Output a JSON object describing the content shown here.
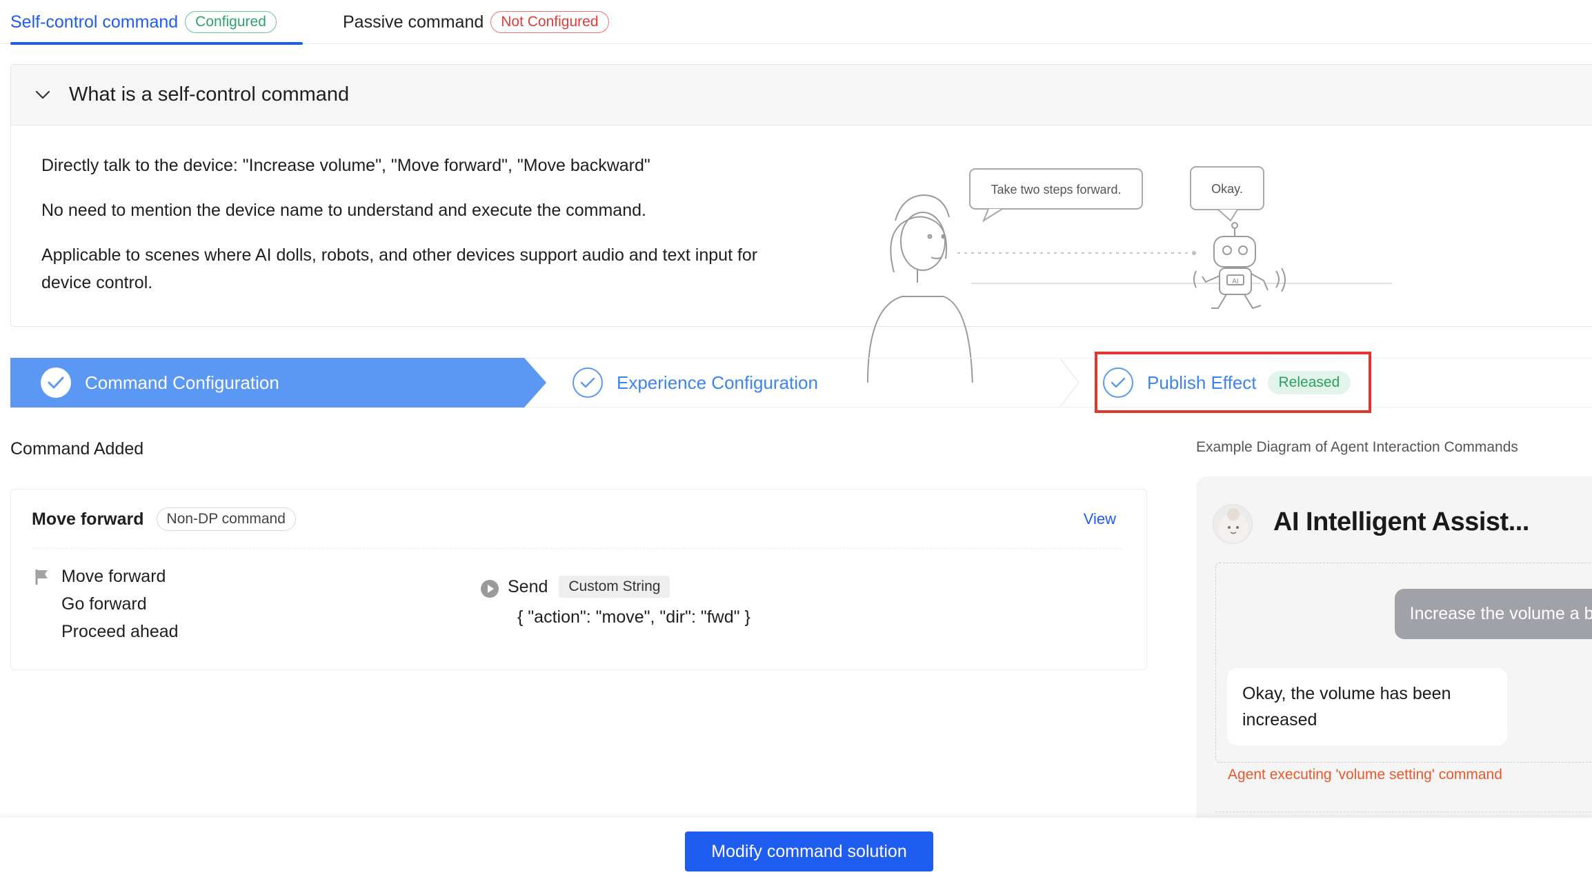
{
  "tabs": [
    {
      "label": "Self-control command",
      "status": "Configured"
    },
    {
      "label": "Passive command",
      "status": "Not Configured"
    }
  ],
  "intro": {
    "title": "What is a self-control command",
    "lines": [
      "Directly talk to the device: \"Increase volume\", \"Move forward\", \"Move backward\"",
      "No need to mention the device name to understand and execute the command.",
      "Applicable to scenes where AI dolls, robots, and other devices support audio and text input for",
      "device control."
    ],
    "illustration": {
      "human_bubble": "Take two steps forward.",
      "robot_bubble": "Okay.",
      "robot_chest_label": "AI"
    }
  },
  "steps": [
    {
      "label": "Command Configuration",
      "state": "active"
    },
    {
      "label": "Experience Configuration",
      "state": "done"
    },
    {
      "label": "Publish Effect",
      "state": "done",
      "badge": "Released"
    }
  ],
  "commands": {
    "section_title": "Command Added",
    "items": [
      {
        "name": "Move forward",
        "type": "Non-DP command",
        "view_label": "View",
        "utterances": [
          "Move forward",
          "Go forward",
          "Proceed ahead"
        ],
        "action_label": "Send",
        "action_type": "Custom String",
        "payload": "{ \"action\": \"move\", \"dir\": \"fwd\" }"
      }
    ]
  },
  "example": {
    "caption": "Example Diagram of Agent Interaction Commands",
    "assistant_name": "AI Intelligent Assist...",
    "user_message": "Increase the volume a bit",
    "bot_message": "Okay, the volume has been increased",
    "exec_note": "Agent executing 'volume setting' command"
  },
  "footer": {
    "primary_button": "Modify command solution"
  },
  "colors": {
    "brand_blue": "#1f5cf0",
    "step_active": "#5b98f3",
    "success_green": "#2ea36f",
    "error_red": "#e03b3b",
    "highlight_box": "#e2352e",
    "exec_note": "#e8582a"
  }
}
